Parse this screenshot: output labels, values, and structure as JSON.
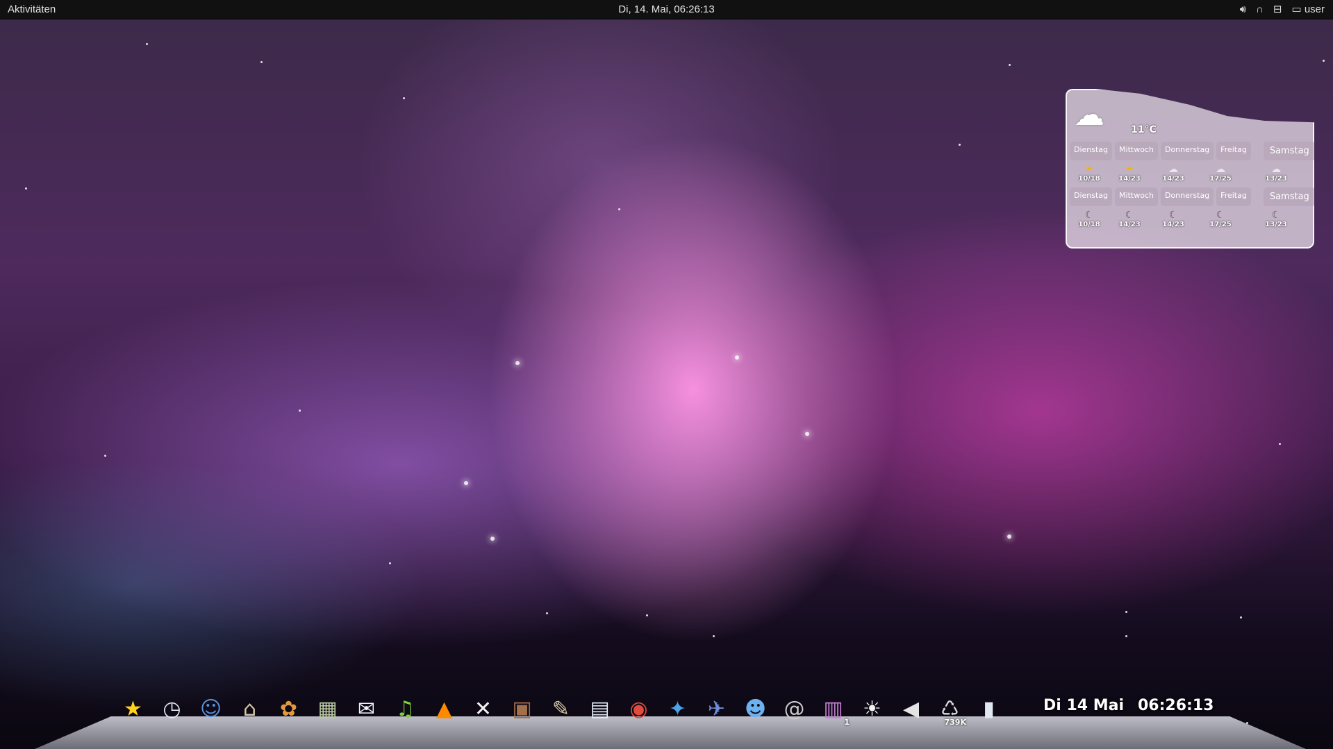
{
  "top_panel": {
    "activities_label": "Aktivitäten",
    "clock": "Di, 14. Mai, 06:26:13",
    "tray": {
      "volume_icon": "volume-icon",
      "headset_icon": "headset-icon",
      "network_icon": "network-icon",
      "user_icon": "user-icon",
      "user_label": "user"
    }
  },
  "weather": {
    "current_temp": "11°C",
    "current_icon": "cloud-icon",
    "days_row1": [
      "Dienstag",
      "Mittwoch",
      "Donnerstag",
      "Freitag",
      "Samstag"
    ],
    "temps_row1": [
      "10/18",
      "14/23",
      "14/23",
      "17/25",
      "13/23"
    ],
    "days_row2": [
      "Dienstag",
      "Mittwoch",
      "Donnerstag",
      "Freitag",
      "Samstag"
    ],
    "temps_row2": [
      "10/18",
      "14/23",
      "14/23",
      "17/25",
      "13/23"
    ]
  },
  "dock": {
    "items": [
      {
        "name": "favorites-star-icon",
        "glyph": "★",
        "color": "#ffd21f"
      },
      {
        "name": "time-machine-icon",
        "glyph": "◷",
        "color": "#dfe6ef"
      },
      {
        "name": "finder-icon",
        "glyph": "☺",
        "color": "#5b8fd8"
      },
      {
        "name": "home-folder-icon",
        "glyph": "⌂",
        "color": "#d9c7a6"
      },
      {
        "name": "software-installer-icon",
        "glyph": "✿",
        "color": "#e49a3c"
      },
      {
        "name": "calculator-icon",
        "glyph": "▦",
        "color": "#b9c9a0"
      },
      {
        "name": "package-icon",
        "glyph": "✉",
        "color": "#eef4f7"
      },
      {
        "name": "music-player-icon",
        "glyph": "♫",
        "color": "#7dd13d"
      },
      {
        "name": "vlc-icon",
        "glyph": "▲",
        "color": "#ff8a00"
      },
      {
        "name": "podcast-icon",
        "glyph": "✕",
        "color": "#f2f2f2"
      },
      {
        "name": "tv-icon",
        "glyph": "▣",
        "color": "#a3704a"
      },
      {
        "name": "gimp-icon",
        "glyph": "✎",
        "color": "#d6c7a1"
      },
      {
        "name": "document-viewer-icon",
        "glyph": "▤",
        "color": "#dde7f2"
      },
      {
        "name": "chrome-icon",
        "glyph": "◉",
        "color": "#e14b3b"
      },
      {
        "name": "safari-icon",
        "glyph": "✦",
        "color": "#4ba3e8"
      },
      {
        "name": "photo-icon",
        "glyph": "✈",
        "color": "#6f8fd9"
      },
      {
        "name": "chat-icon",
        "glyph": "☻",
        "color": "#6db2ef"
      },
      {
        "name": "mail-icon",
        "glyph": "@",
        "color": "#c9c9c9"
      },
      {
        "name": "workspace-switcher-icon",
        "glyph": "▥",
        "color": "#c780d8",
        "badge": "1"
      },
      {
        "name": "brightness-icon",
        "glyph": "☀",
        "color": "#f1f1f1"
      },
      {
        "name": "volume-icon",
        "glyph": "◀",
        "color": "#e4e4e4"
      },
      {
        "name": "trash-icon",
        "glyph": "♺",
        "color": "#d9d9d9",
        "badge": "739K"
      },
      {
        "name": "clock-app-icon",
        "glyph": "▮",
        "color": "#dfe7f1"
      }
    ],
    "date": "Di 14 Mai",
    "time": "06:26:13"
  }
}
